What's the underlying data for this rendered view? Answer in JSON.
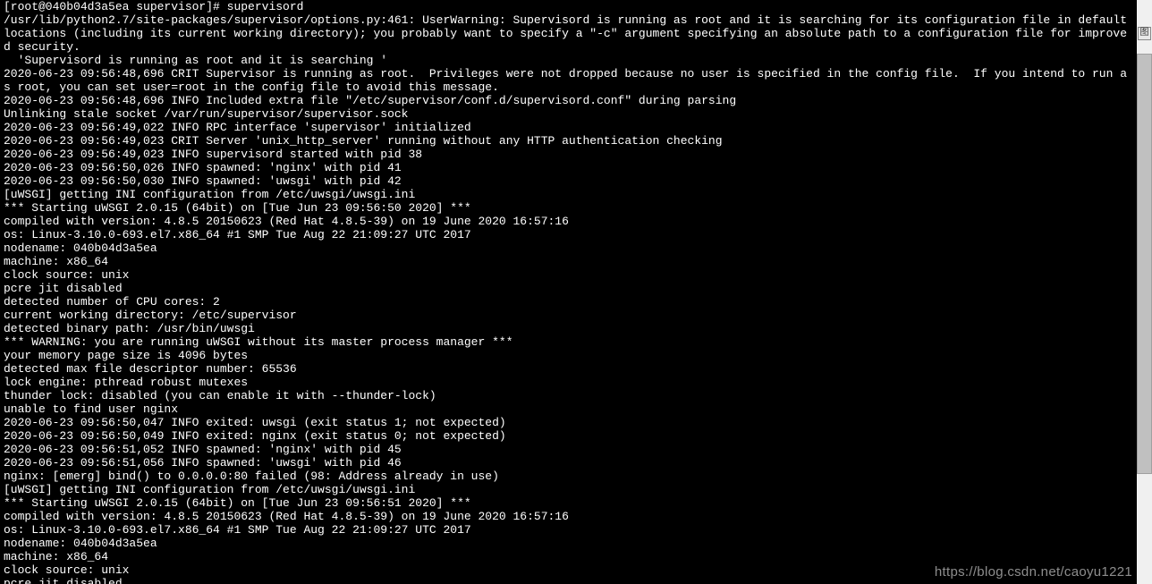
{
  "terminal": {
    "lines": [
      "[root@040b04d3a5ea supervisor]# supervisord",
      "/usr/lib/python2.7/site-packages/supervisor/options.py:461: UserWarning: Supervisord is running as root and it is searching for its configuration file in default locations (including its current working directory); you probably want to specify a \"-c\" argument specifying an absolute path to a configuration file for improved security.",
      "  'Supervisord is running as root and it is searching '",
      "2020-06-23 09:56:48,696 CRIT Supervisor is running as root.  Privileges were not dropped because no user is specified in the config file.  If you intend to run as root, you can set user=root in the config file to avoid this message.",
      "2020-06-23 09:56:48,696 INFO Included extra file \"/etc/supervisor/conf.d/supervisord.conf\" during parsing",
      "Unlinking stale socket /var/run/supervisor/supervisor.sock",
      "2020-06-23 09:56:49,022 INFO RPC interface 'supervisor' initialized",
      "2020-06-23 09:56:49,023 CRIT Server 'unix_http_server' running without any HTTP authentication checking",
      "2020-06-23 09:56:49,023 INFO supervisord started with pid 38",
      "2020-06-23 09:56:50,026 INFO spawned: 'nginx' with pid 41",
      "2020-06-23 09:56:50,030 INFO spawned: 'uwsgi' with pid 42",
      "[uWSGI] getting INI configuration from /etc/uwsgi/uwsgi.ini",
      "*** Starting uWSGI 2.0.15 (64bit) on [Tue Jun 23 09:56:50 2020] ***",
      "compiled with version: 4.8.5 20150623 (Red Hat 4.8.5-39) on 19 June 2020 16:57:16",
      "os: Linux-3.10.0-693.el7.x86_64 #1 SMP Tue Aug 22 21:09:27 UTC 2017",
      "nodename: 040b04d3a5ea",
      "machine: x86_64",
      "clock source: unix",
      "pcre jit disabled",
      "detected number of CPU cores: 2",
      "current working directory: /etc/supervisor",
      "detected binary path: /usr/bin/uwsgi",
      "*** WARNING: you are running uWSGI without its master process manager ***",
      "your memory page size is 4096 bytes",
      "detected max file descriptor number: 65536",
      "lock engine: pthread robust mutexes",
      "thunder lock: disabled (you can enable it with --thunder-lock)",
      "unable to find user nginx",
      "2020-06-23 09:56:50,047 INFO exited: uwsgi (exit status 1; not expected)",
      "2020-06-23 09:56:50,049 INFO exited: nginx (exit status 0; not expected)",
      "2020-06-23 09:56:51,052 INFO spawned: 'nginx' with pid 45",
      "2020-06-23 09:56:51,056 INFO spawned: 'uwsgi' with pid 46",
      "nginx: [emerg] bind() to 0.0.0.0:80 failed (98: Address already in use)",
      "[uWSGI] getting INI configuration from /etc/uwsgi/uwsgi.ini",
      "*** Starting uWSGI 2.0.15 (64bit) on [Tue Jun 23 09:56:51 2020] ***",
      "compiled with version: 4.8.5 20150623 (Red Hat 4.8.5-39) on 19 June 2020 16:57:16",
      "os: Linux-3.10.0-693.el7.x86_64 #1 SMP Tue Aug 22 21:09:27 UTC 2017",
      "nodename: 040b04d3a5ea",
      "machine: x86_64",
      "clock source: unix",
      "pcre jit disabled"
    ]
  },
  "watermark": {
    "text": "https://blog.csdn.net/caoyu1221"
  },
  "corner_icon": {
    "label": "图"
  }
}
